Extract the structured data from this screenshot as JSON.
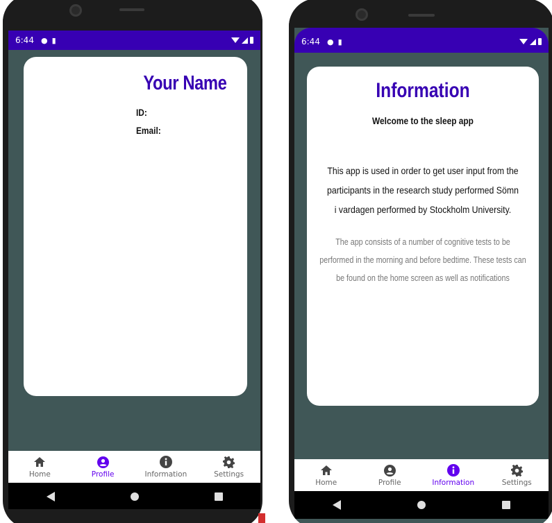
{
  "status_bar": {
    "time": "6:44"
  },
  "profile_screen": {
    "name": "Your Name",
    "id_label": "ID:",
    "email_label": "Email:"
  },
  "information_screen": {
    "title": "Information",
    "welcome": "Welcome to the sleep app",
    "paragraph1": "This app is used in order to get user input from the participants in the research study performed Sömn i vardagen performed by Stockholm University.",
    "paragraph2": "The app consists of a number of cognitive tests to be performed in the morning and before bedtime. These tests can be found on the home screen as well as notifications"
  },
  "nav": {
    "home": "Home",
    "profile": "Profile",
    "information": "Information",
    "settings": "Settings"
  },
  "colors": {
    "accent": "#3700b3",
    "active_tab": "#6200ee",
    "background": "#405757"
  },
  "icons": [
    "home-icon",
    "account-circle-icon",
    "info-icon",
    "gear-icon",
    "back-icon",
    "home-circle-icon",
    "recents-icon",
    "wifi-icon",
    "signal-icon",
    "battery-icon"
  ]
}
